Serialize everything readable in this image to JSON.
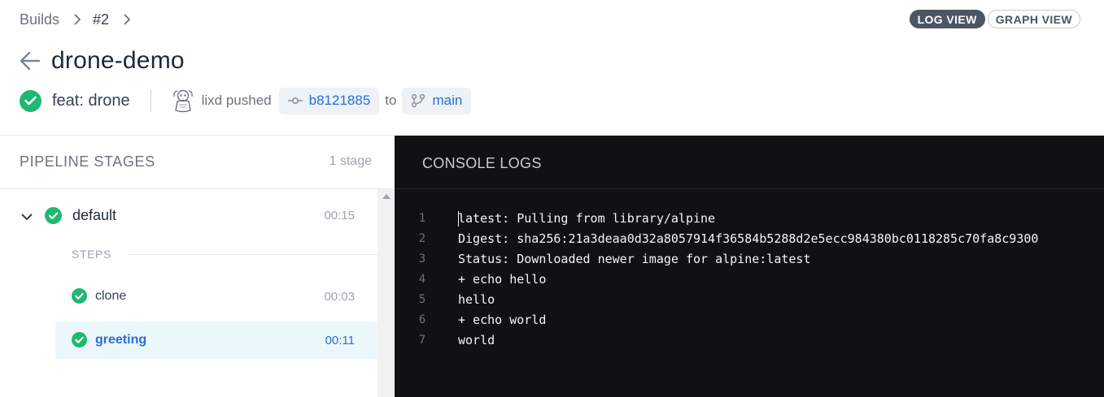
{
  "breadcrumb": {
    "builds": "Builds",
    "build_number": "#2"
  },
  "view_toggle": {
    "log_view": "LOG VIEW",
    "graph_view": "GRAPH VIEW",
    "active": "log_view"
  },
  "repo": {
    "title": "drone-demo"
  },
  "commit": {
    "message": "feat: drone",
    "status": "success",
    "pusher_text": "lixd pushed",
    "sha": "b8121885",
    "to_word": "to",
    "branch": "main"
  },
  "pipeline": {
    "title": "PIPELINE STAGES",
    "count": "1 stage",
    "stage": {
      "name": "default",
      "duration": "00:15",
      "status": "success"
    },
    "steps_label": "STEPS",
    "steps": [
      {
        "name": "clone",
        "duration": "00:03",
        "status": "success",
        "selected": false
      },
      {
        "name": "greeting",
        "duration": "00:11",
        "status": "success",
        "selected": true
      }
    ]
  },
  "console": {
    "title": "CONSOLE LOGS",
    "lines": [
      {
        "num": "1",
        "text": "latest: Pulling from library/alpine"
      },
      {
        "num": "2",
        "text": "Digest: sha256:21a3deaa0d32a8057914f36584b5288d2e5ecc984380bc0118285c70fa8c9300"
      },
      {
        "num": "3",
        "text": "Status: Downloaded newer image for alpine:latest"
      },
      {
        "num": "4",
        "text": "+ echo hello"
      },
      {
        "num": "5",
        "text": "hello"
      },
      {
        "num": "6",
        "text": "+ echo world"
      },
      {
        "num": "7",
        "text": "world"
      }
    ]
  },
  "colors": {
    "success": "#1fb871",
    "link": "#2a6ed6",
    "console_bg": "#111113",
    "selected_bg": "#ecf7fc"
  }
}
